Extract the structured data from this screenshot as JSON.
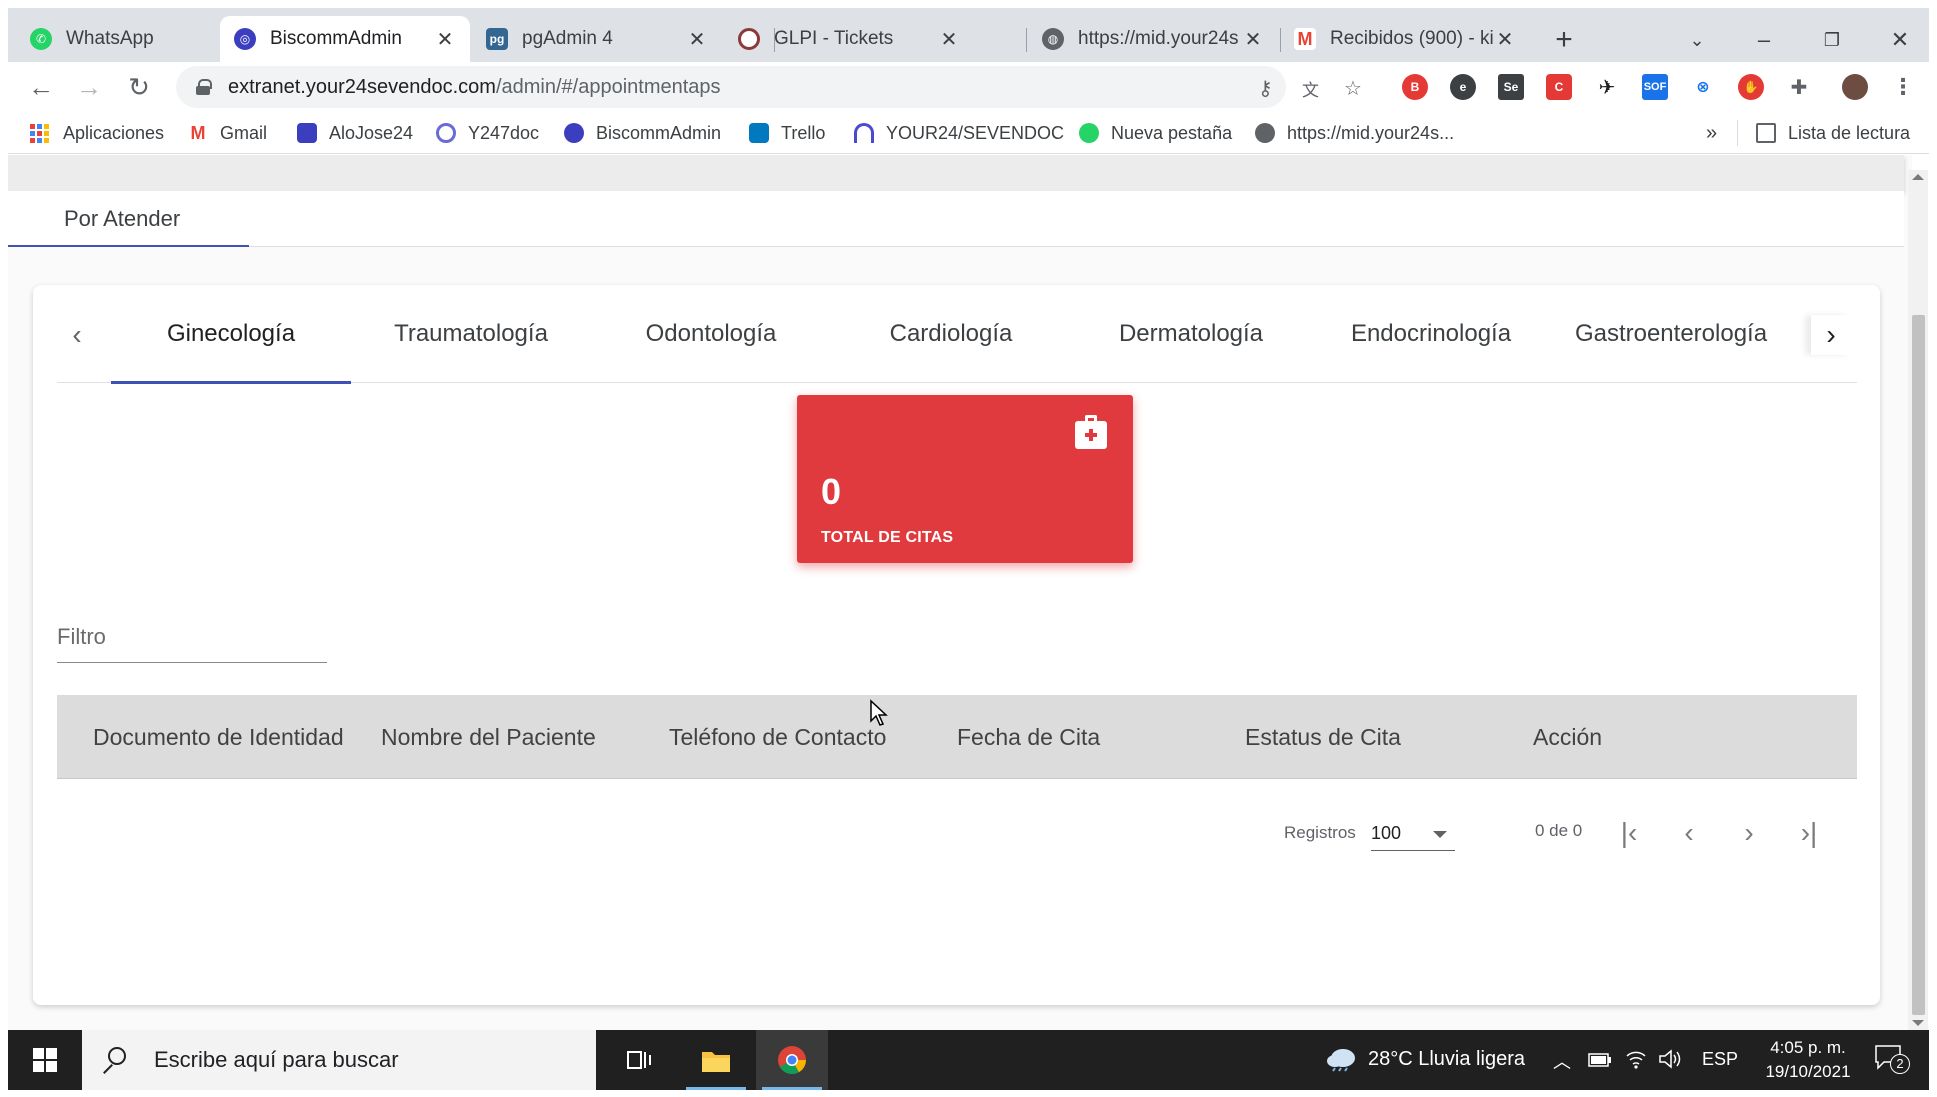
{
  "browser": {
    "tabs": [
      {
        "title": "WhatsApp",
        "icon": "whatsapp-icon",
        "color": "#25d366"
      },
      {
        "title": "BiscommAdmin",
        "icon": "biscomm-icon",
        "color": "#3b3fbf"
      },
      {
        "title": "pgAdmin 4",
        "icon": "pgadmin-icon",
        "color": "#336791"
      },
      {
        "title": "GLPI - Tickets",
        "icon": "glpi-icon",
        "color": "#8a3a3a"
      },
      {
        "title": "https://mid.your24s",
        "icon": "globe-icon",
        "color": "#5f6368"
      },
      {
        "title": "Recibidos (900) - ki",
        "icon": "gmail-icon",
        "color": "#ea4335"
      }
    ],
    "active_tab": 1,
    "url_host": "extranet.your24sevendoc.com",
    "url_path": "/admin/#/appointmentaps",
    "bookmarks": [
      {
        "label": "Aplicaciones",
        "icon": "apps-icon"
      },
      {
        "label": "Gmail",
        "icon": "gmail-icon",
        "color": "#ea4335"
      },
      {
        "label": "AloJose24",
        "icon": "bookmark-icon",
        "color": "#3b3fbf"
      },
      {
        "label": "Y247doc",
        "icon": "bookmark-icon",
        "color": "#6a6ad8"
      },
      {
        "label": "BiscommAdmin",
        "icon": "biscomm-icon",
        "color": "#3b3fbf"
      },
      {
        "label": "Trello",
        "icon": "trello-icon",
        "color": "#0079bf"
      },
      {
        "label": "YOUR24/SEVENDOC",
        "icon": "bookmark-icon",
        "color": "#4a4ad0"
      },
      {
        "label": "Nueva pestaña",
        "icon": "whatsapp-icon",
        "color": "#25d366"
      },
      {
        "label": "https://mid.your24s...",
        "icon": "globe-icon",
        "color": "#5f6368"
      }
    ],
    "more_bookmarks": "»",
    "reading_list": "Lista de lectura"
  },
  "page": {
    "main_tab": "Por Atender",
    "specialties": [
      "Ginecología",
      "Traumatología",
      "Odontología",
      "Cardiología",
      "Dermatología",
      "Endocrinología",
      "Gastroenterología"
    ],
    "active_specialty": 0,
    "stat_card": {
      "value": "0",
      "label": "TOTAL DE CITAS",
      "color": "#e0393e",
      "icon": "medical-kit-icon"
    },
    "filter_placeholder": "Filtro",
    "columns": [
      "Documento de Identidad",
      "Nombre del Paciente",
      "Teléfono de Contacto",
      "Fecha de Cita",
      "Estatus de Cita",
      "Acción"
    ],
    "rows": [],
    "paginator": {
      "label": "Registros",
      "page_size": "100",
      "range": "0 de 0"
    }
  },
  "taskbar": {
    "search_placeholder": "Escribe aquí para buscar",
    "weather": "28°C  Lluvia ligera",
    "language": "ESP",
    "time": "4:05 p. m.",
    "date": "19/10/2021",
    "notifications": "2"
  }
}
